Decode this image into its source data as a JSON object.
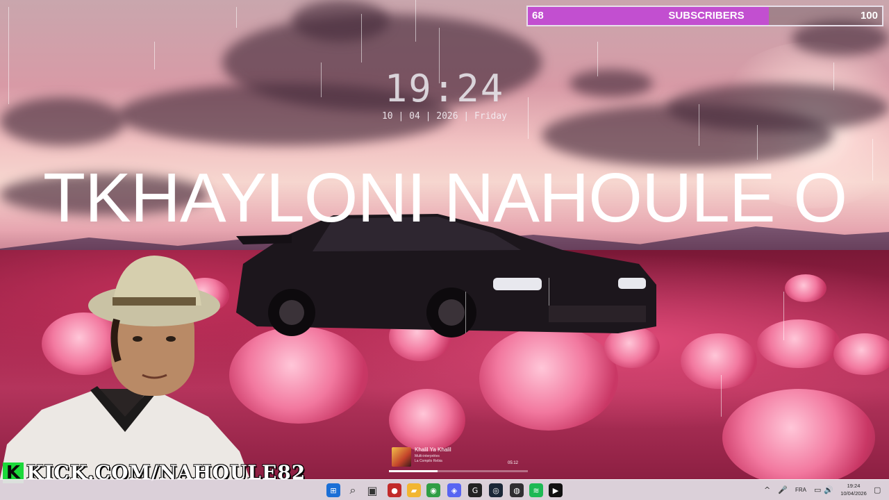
{
  "overlay": {
    "clock_time": "19:24",
    "clock_date": "10 | 04 | 2026 | Friday",
    "big_text": "TKHAYLONI NAHOULE O",
    "subscribers": {
      "label": "SUBSCRIBERS",
      "current": "68",
      "goal": "100",
      "progress": 0.68,
      "fill_color": "#c24fd0"
    },
    "kick": {
      "url": "KICK.COM/NAHOULE82",
      "logo_letter": "K",
      "brand_color": "#1bd93a"
    }
  },
  "music_widget": {
    "title": "Khalil Ya Khalil",
    "artist": "Multi-interprètes",
    "album": "La Compilo Rebia",
    "time": "05:12",
    "progress": 0.35
  },
  "taskbar": {
    "icons": [
      {
        "name": "windows-start-icon",
        "glyph": "⊞",
        "color": "#1b6fd6"
      },
      {
        "name": "search-icon",
        "glyph": "⌕",
        "color": "#333333"
      },
      {
        "name": "task-view-icon",
        "glyph": "▣",
        "color": "#333333"
      },
      {
        "name": "record-app-icon",
        "glyph": "●",
        "color": "#c22a2a"
      },
      {
        "name": "file-explorer-icon",
        "glyph": "▰",
        "color": "#f2b632"
      },
      {
        "name": "chrome-icon",
        "glyph": "◉",
        "color": "#2f9e44"
      },
      {
        "name": "discord-icon",
        "glyph": "◈",
        "color": "#5865f2"
      },
      {
        "name": "app-g-icon",
        "glyph": "G",
        "color": "#222222"
      },
      {
        "name": "steam-icon",
        "glyph": "◎",
        "color": "#1b2838"
      },
      {
        "name": "obs-icon",
        "glyph": "◍",
        "color": "#302e31"
      },
      {
        "name": "spotify-icon",
        "glyph": "≋",
        "color": "#1db954"
      },
      {
        "name": "stream-app-icon",
        "glyph": "▶",
        "color": "#111111"
      }
    ],
    "tray": {
      "chevron": "^",
      "mic": "🎤",
      "language": "FRA",
      "network": "▭",
      "volume": "🔊",
      "time": "19:24",
      "date": "10/04/2026",
      "notification": "▢"
    }
  }
}
